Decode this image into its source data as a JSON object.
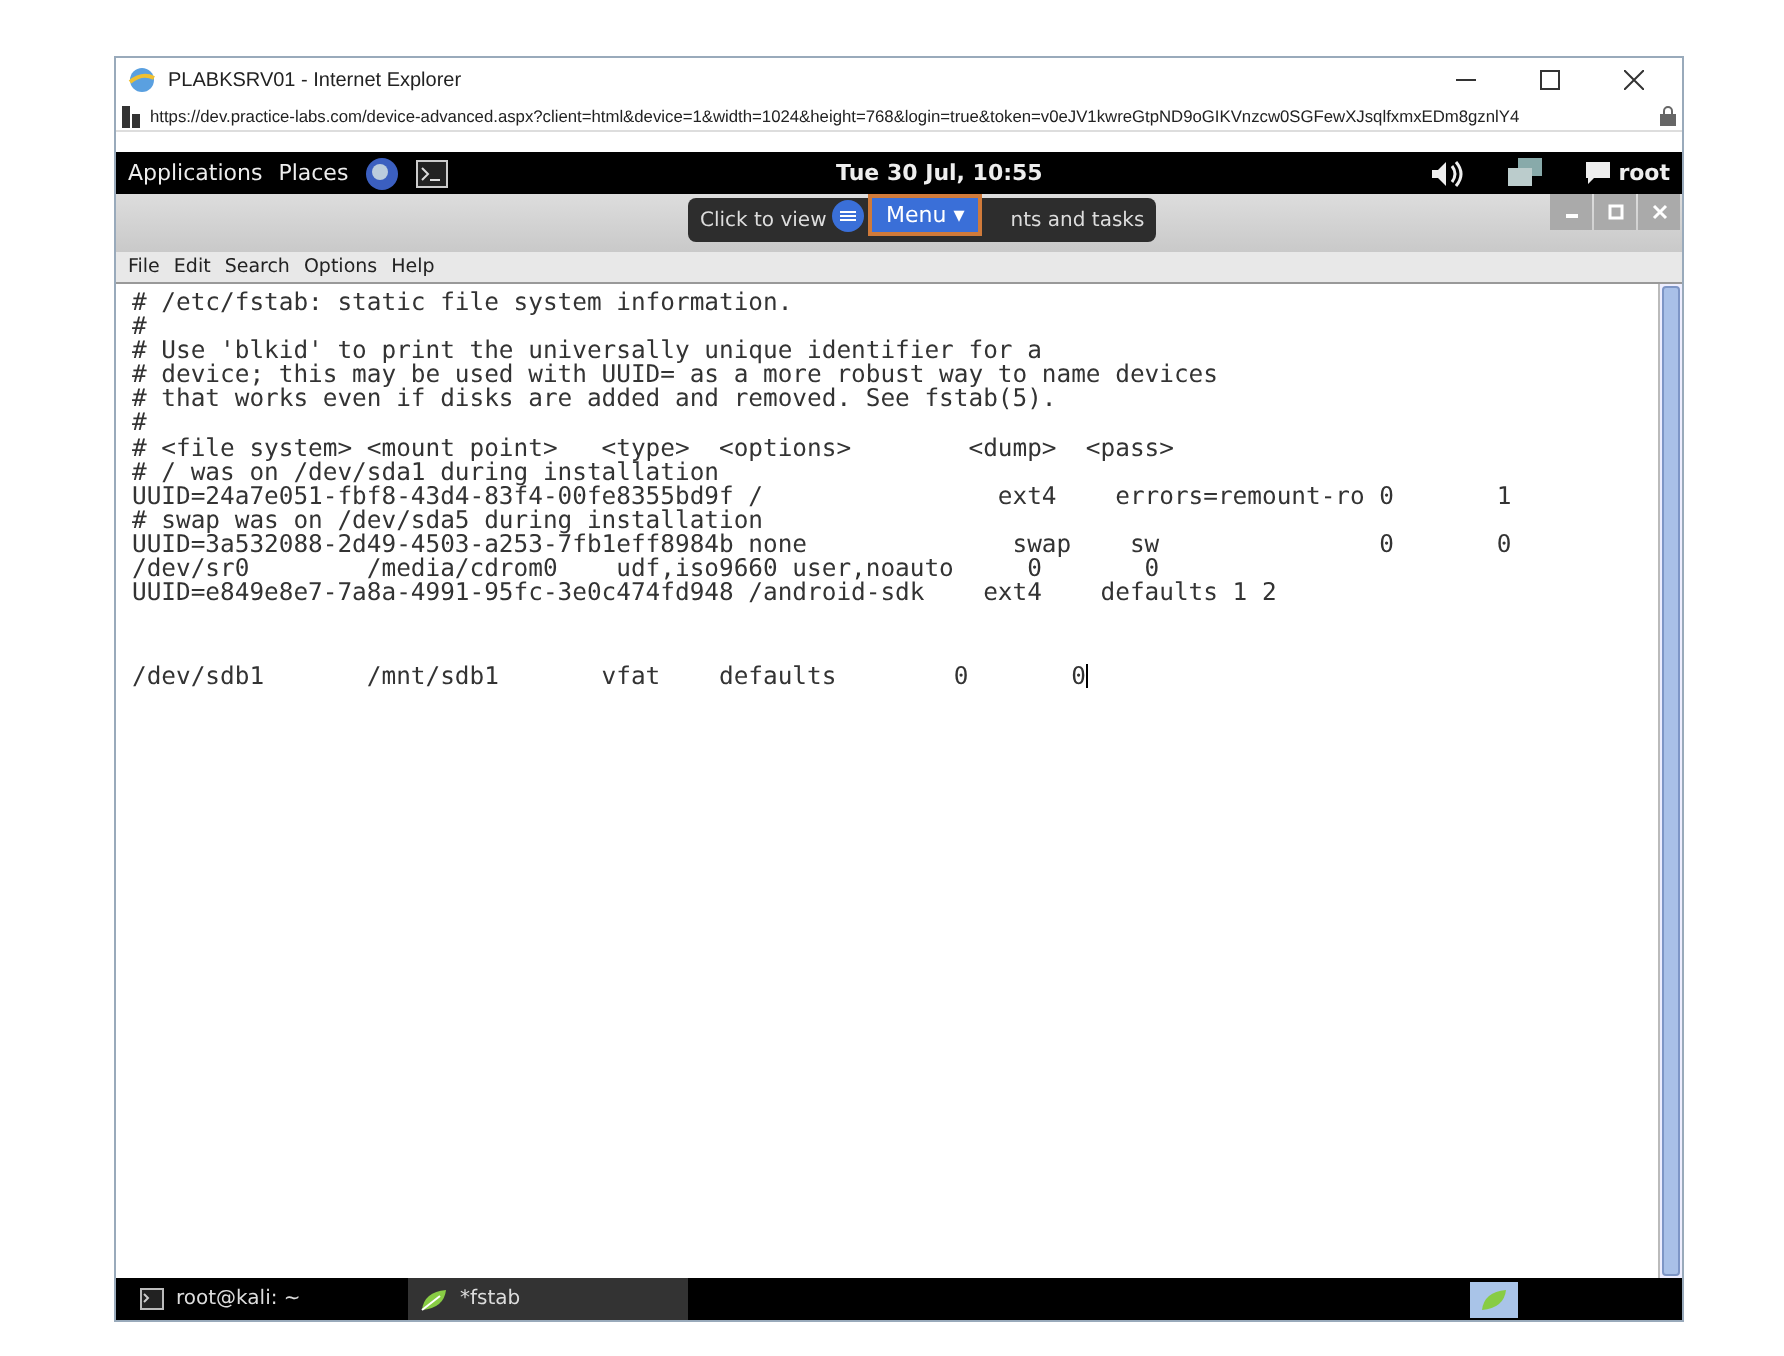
{
  "browser": {
    "title": "PLABKSRV01 - Internet Explorer",
    "url": "https://dev.practice-labs.com/device-advanced.aspx?client=html&device=1&width=1024&height=768&login=true&token=v0eJV1kwreGtpND9oGIKVnzcw0SGFewXJsqlfxmxEDm8gznlY4"
  },
  "top_bar": {
    "menus": [
      "Applications",
      "Places"
    ],
    "clock": "Tue 30 Jul, 10:55",
    "user": "root"
  },
  "overlay": {
    "tooltip_parts": [
      "Click to view",
      "nts and tasks"
    ],
    "menu_button": "Menu ▾"
  },
  "editor": {
    "menus": [
      "File",
      "Edit",
      "Search",
      "Options",
      "Help"
    ],
    "lines": [
      {
        "kind": "text",
        "text": "# /etc/fstab: static file system information."
      },
      {
        "kind": "text",
        "text": "#"
      },
      {
        "kind": "text",
        "text": "# Use 'blkid' to print the universally unique identifier for a"
      },
      {
        "kind": "text",
        "text": "# device; this may be used with UUID= as a more robust way to name devices"
      },
      {
        "kind": "text",
        "text": "# that works even if disks are added and removed. See fstab(5)."
      },
      {
        "kind": "text",
        "text": "#"
      },
      {
        "kind": "text",
        "text": "# <file system> <mount point>   <type>  <options>        <dump>  <pass>"
      },
      {
        "kind": "text",
        "text": "# / was on /dev/sda1 during installation"
      },
      {
        "kind": "text",
        "text": "UUID=24a7e051-fbf8-43d4-83f4-00fe8355bd9f /                ext4    errors=remount-ro 0       1"
      },
      {
        "kind": "text",
        "text": "# swap was on /dev/sda5 during installation"
      },
      {
        "kind": "text",
        "text": "UUID=3a532088-2d49-4503-a253-7fb1eff8984b none              swap    sw               0       0"
      },
      {
        "kind": "text",
        "text": "/dev/sr0        /media/cdrom0    udf,iso9660 user,noauto     0       0"
      },
      {
        "kind": "text",
        "text": "UUID=e849e8e7-7a8a-4991-95fc-3e0c474fd948 /android-sdk    ext4    defaults 1 2"
      },
      {
        "kind": "blank"
      },
      {
        "kind": "text",
        "text": "/dev/sdb1       /mnt/sdb1       vfat    defaults        0       0",
        "cursor": true
      }
    ]
  },
  "taskbar": {
    "items": [
      {
        "label": "root@kali: ~",
        "selected": false
      },
      {
        "label": "*fstab",
        "selected": true
      }
    ]
  }
}
